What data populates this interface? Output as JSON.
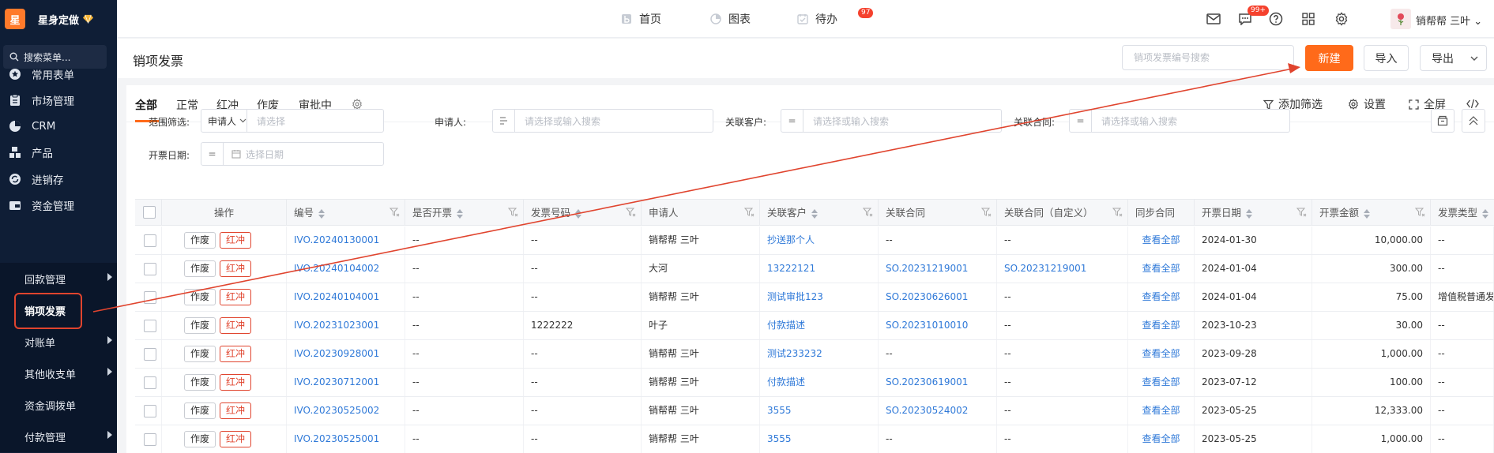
{
  "app": {
    "name": "星身定做",
    "logo_char": "星"
  },
  "sidebar": {
    "search_placeholder": "搜索菜单...",
    "items": [
      {
        "label": "常用表单",
        "icon": "star-icon"
      },
      {
        "label": "市场管理",
        "icon": "clipboard-icon"
      },
      {
        "label": "CRM",
        "icon": "pie-icon"
      },
      {
        "label": "产品",
        "icon": "boxes-icon"
      },
      {
        "label": "进销存",
        "icon": "cycle-icon"
      },
      {
        "label": "资金管理",
        "icon": "wallet-icon"
      }
    ],
    "subitems": [
      {
        "label": "回款管理",
        "has_children": true
      },
      {
        "label": "销项发票",
        "has_children": false,
        "active": true
      },
      {
        "label": "对账单",
        "has_children": true
      },
      {
        "label": "其他收支单",
        "has_children": true
      },
      {
        "label": "资金调拨单",
        "has_children": false
      },
      {
        "label": "付款管理",
        "has_children": true
      }
    ]
  },
  "topbar": {
    "nav": [
      {
        "label": "首页",
        "icon": "home-icon"
      },
      {
        "label": "图表",
        "icon": "chart-icon"
      },
      {
        "label": "待办",
        "icon": "todo-icon",
        "badge": "97"
      }
    ],
    "message_badge": "99+",
    "user_name": "销帮帮 三叶"
  },
  "page": {
    "title": "销项发票",
    "search_placeholder": "销项发票编号搜索",
    "new_label": "新建",
    "import_label": "导入",
    "export_label": "导出"
  },
  "tabs": [
    "全部",
    "正常",
    "红冲",
    "作废",
    "审批中"
  ],
  "toolbar": {
    "add_filter": "添加筛选",
    "settings": "设置",
    "fullscreen": "全屏"
  },
  "filters": {
    "range_label": "范围筛选:",
    "range_value": "申请人",
    "range_placeholder": "请选择",
    "applicant_label": "申请人:",
    "applicant_placeholder": "请选择或输入搜索",
    "customer_label": "关联客户:",
    "customer_placeholder": "请选择或输入搜索",
    "contract_label": "关联合同:",
    "contract_placeholder": "请选择或输入搜索",
    "date_label": "开票日期:",
    "date_placeholder": "选择日期",
    "eq_symbol": "="
  },
  "table": {
    "headers": [
      "操作",
      "编号",
      "是否开票",
      "发票号码",
      "申请人",
      "关联客户",
      "关联合同",
      "关联合同（自定义）",
      "同步合同",
      "开票日期",
      "开票金额",
      "发票类型"
    ],
    "action_void": "作废",
    "action_red": "红冲",
    "rows": [
      {
        "no": "IVO.20240130001",
        "issued": "--",
        "invoice_no": "--",
        "applicant": "销帮帮 三叶",
        "customer": "抄送那个人",
        "contract": "--",
        "contract_custom": "--",
        "sync": "查看全部",
        "date": "2024-01-30",
        "amount": "10,000.00",
        "type": "--"
      },
      {
        "no": "IVO.20240104002",
        "issued": "--",
        "invoice_no": "--",
        "applicant": "大河",
        "customer": "13222121",
        "contract": "SO.20231219001",
        "contract_custom": "SO.20231219001",
        "sync": "查看全部",
        "date": "2024-01-04",
        "amount": "300.00",
        "type": "--"
      },
      {
        "no": "IVO.20240104001",
        "issued": "--",
        "invoice_no": "--",
        "applicant": "销帮帮 三叶",
        "customer": "测试审批123",
        "contract": "SO.20230626001",
        "contract_custom": "--",
        "sync": "查看全部",
        "date": "2024-01-04",
        "amount": "75.00",
        "type": "增值税普通发票"
      },
      {
        "no": "IVO.20231023001",
        "issued": "--",
        "invoice_no": "1222222",
        "applicant": "叶子",
        "customer": "付款描述",
        "contract": "SO.20231010010",
        "contract_custom": "--",
        "sync": "查看全部",
        "date": "2023-10-23",
        "amount": "30.00",
        "type": "--"
      },
      {
        "no": "IVO.20230928001",
        "issued": "--",
        "invoice_no": "--",
        "applicant": "销帮帮 三叶",
        "customer": "测试233232",
        "contract": "--",
        "contract_custom": "--",
        "sync": "查看全部",
        "date": "2023-09-28",
        "amount": "1,000.00",
        "type": "--"
      },
      {
        "no": "IVO.20230712001",
        "issued": "--",
        "invoice_no": "--",
        "applicant": "销帮帮 三叶",
        "customer": "付款描述",
        "contract": "SO.20230619001",
        "contract_custom": "--",
        "sync": "查看全部",
        "date": "2023-07-12",
        "amount": "100.00",
        "type": "--"
      },
      {
        "no": "IVO.20230525002",
        "issued": "--",
        "invoice_no": "--",
        "applicant": "销帮帮 三叶",
        "customer": "3555",
        "contract": "SO.20230524002",
        "contract_custom": "--",
        "sync": "查看全部",
        "date": "2023-05-25",
        "amount": "12,333.00",
        "type": "--"
      },
      {
        "no": "IVO.20230525001",
        "issued": "--",
        "invoice_no": "--",
        "applicant": "销帮帮 三叶",
        "customer": "3555",
        "contract": "--",
        "contract_custom": "--",
        "sync": "查看全部",
        "date": "2023-05-25",
        "amount": "1,000.00",
        "type": "--"
      }
    ]
  },
  "colors": {
    "accent": "#ff6a1a",
    "link": "#2f79d8",
    "sidebar_bg": "#0f1e36",
    "annotation": "#e0442e"
  }
}
